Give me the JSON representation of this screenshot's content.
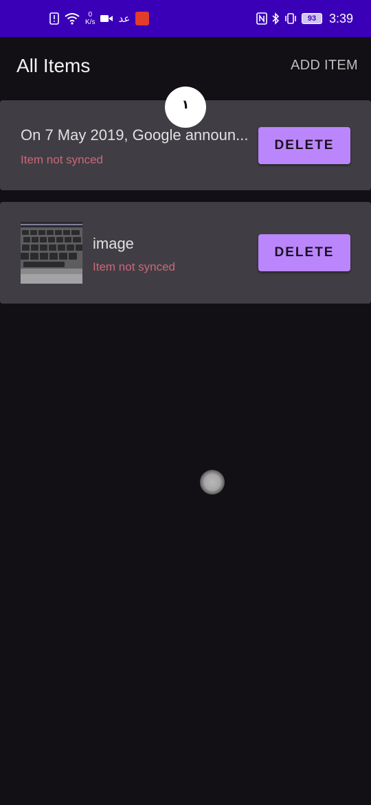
{
  "status_bar": {
    "net_speed_value": "0",
    "net_speed_unit": "K/s",
    "carrier_glyph": "ﻋﺪ",
    "battery": "93",
    "time": "3:39",
    "icons": [
      "alert-icon",
      "wifi-icon",
      "video-icon",
      "carrier-icon",
      "app-badge-icon",
      "nfc-icon",
      "bluetooth-icon",
      "vibrate-icon",
      "battery-icon"
    ]
  },
  "app_bar": {
    "title": "All Items",
    "add_item_label": "ADD ITEM"
  },
  "items": [
    {
      "title": "On 7 May 2019, Google announ...",
      "status": "Item not synced",
      "delete_label": "DELETE",
      "has_thumbnail": false
    },
    {
      "title": "image",
      "status": "Item not synced",
      "delete_label": "DELETE",
      "has_thumbnail": true,
      "thumbnail": "keyboard-photo"
    }
  ],
  "overlay": {
    "bubble_text": "١"
  },
  "colors": {
    "status_bar": "#3a00b8",
    "background": "#121014",
    "card": "#403e44",
    "accent_button": "#bb86fc",
    "error_text": "#cf6679"
  }
}
